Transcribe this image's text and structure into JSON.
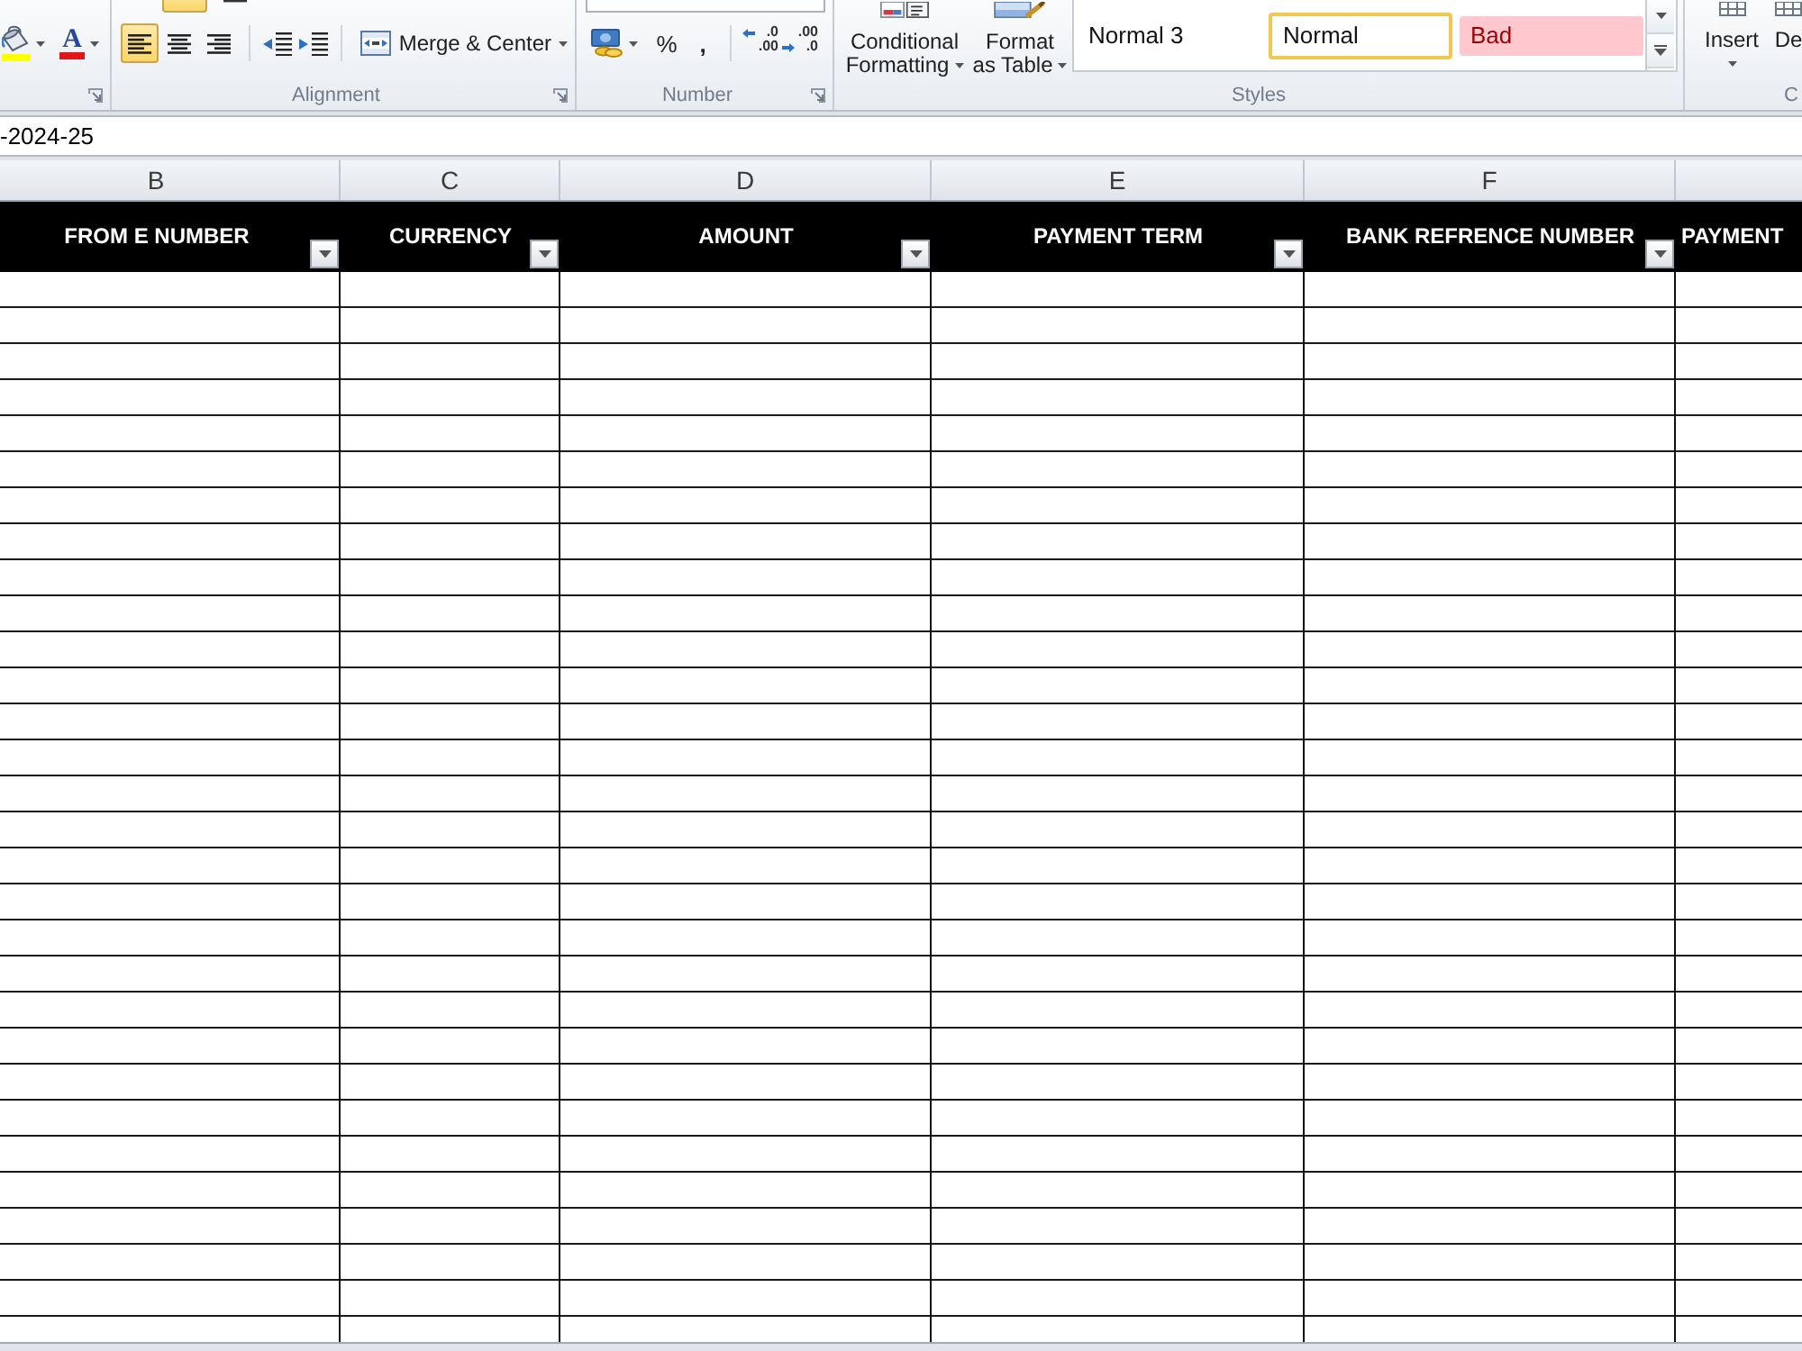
{
  "ribbon": {
    "font_group": {
      "font_color_glyph": "A"
    },
    "alignment_group": {
      "title": "Alignment",
      "vertical_align": [
        {
          "selected": true
        },
        {
          "selected": false
        }
      ],
      "horizontal_align": [
        {
          "kind": "left",
          "selected": true
        },
        {
          "kind": "center",
          "selected": false
        },
        {
          "kind": "right",
          "selected": false
        }
      ],
      "indent_buttons": [
        {
          "kind": "decrease"
        },
        {
          "kind": "increase"
        }
      ],
      "merge_button": "Merge & Center"
    },
    "number_group": {
      "title": "Number",
      "percent_button": "%",
      "comma_button": ",",
      "decimal_buttons": [
        {
          "kind": "increase",
          "lines": [
            ".0",
            ".00"
          ]
        },
        {
          "kind": "decrease",
          "lines": [
            ".00",
            ".0"
          ]
        }
      ]
    },
    "styles_group": {
      "title": "Styles",
      "buttons": [
        {
          "kind": "conditional",
          "lines": [
            "Conditional",
            "Formatting"
          ]
        },
        {
          "kind": "table",
          "lines": [
            "Format",
            "as Table"
          ]
        }
      ],
      "gallery": [
        {
          "label": "Normal 3",
          "kind": "plain",
          "selected": false
        },
        {
          "label": "Normal",
          "kind": "plain",
          "selected": true
        },
        {
          "label": "Bad",
          "kind": "bad",
          "selected": false
        }
      ]
    },
    "cells_group": {
      "title": "C",
      "buttons": [
        {
          "label": "Insert",
          "has_menu": true
        },
        {
          "label": "De",
          "has_menu": false
        }
      ]
    }
  },
  "formula_bar": {
    "value": "-2024-25"
  },
  "sheet": {
    "columns": [
      {
        "letter": "B",
        "heading": "FROM E NUMBER",
        "filter": true
      },
      {
        "letter": "C",
        "heading": "CURRENCY",
        "filter": true
      },
      {
        "letter": "D",
        "heading": "AMOUNT",
        "filter": true
      },
      {
        "letter": "E",
        "heading": "PAYMENT TERM",
        "filter": true
      },
      {
        "letter": "F",
        "heading": "BANK REFRENCE NUMBER",
        "filter": true
      },
      {
        "heading": "PAYMENT",
        "filter": false
      }
    ]
  }
}
